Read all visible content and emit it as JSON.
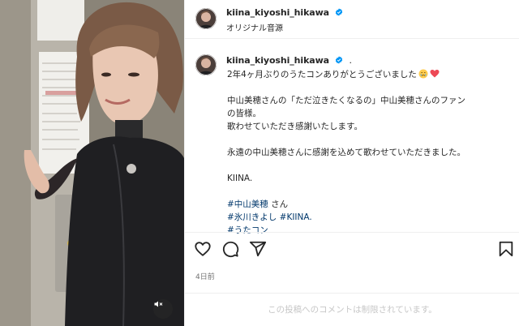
{
  "post": {
    "username": "kiina_kiyoshi_hikawa",
    "audio": "オリジナル音源",
    "caption_dot": ".",
    "caption_lines": [
      "2年4ヶ月ぶりのうたコンありがとうございました",
      "中山美穂さんの「ただ泣きたくなるの」中山美穂さんのファン",
      "の皆様。",
      "歌わせていただき感謝いたします。",
      "永遠の中山美穂さんに感謝を込めて歌わせていただきました。",
      "KIINA."
    ],
    "hashtags": {
      "tag1": "#中山美穂",
      "tag1_suffix": " さん",
      "tag2": "#氷川きよし",
      "tag3": "#KIINA.",
      "tag4": "#うたコン"
    },
    "timestamp": "4日前",
    "comments_disabled": "この投稿へのコメントは制限されています。"
  },
  "icons": {
    "verified": "verified-badge-icon",
    "emoji_1": "crying-face-emoji",
    "emoji_2": "red-heart-emoji",
    "like": "heart-icon",
    "comment": "comment-bubble-icon",
    "share": "paper-plane-icon",
    "save": "bookmark-icon",
    "mute": "speaker-muted-icon"
  },
  "colors": {
    "verified": "#0095f6",
    "hashtag": "#00376b",
    "heart_emoji": "#ed4956",
    "muted_text": "#737373",
    "comments_disabled_text": "#c7c7c7"
  }
}
